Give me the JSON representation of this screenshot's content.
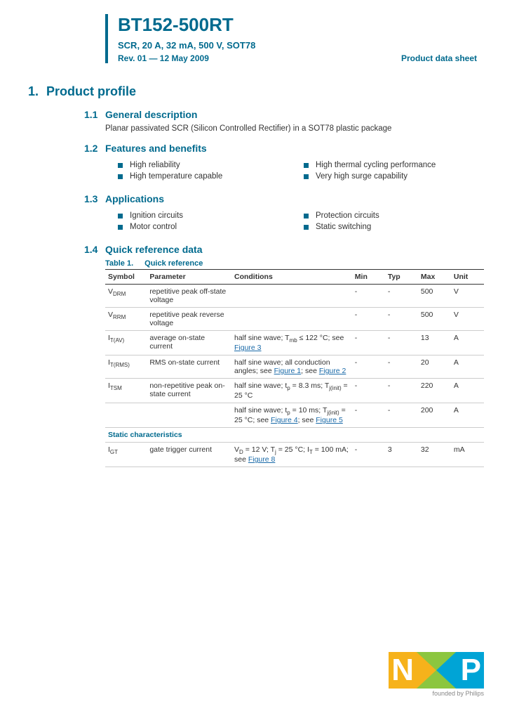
{
  "header": {
    "part_number": "BT152-500RT",
    "subtitle": "SCR, 20 A, 32 mA, 500 V, SOT78",
    "revision": "Rev. 01 — 12 May 2009",
    "sheet_type": "Product data sheet"
  },
  "sections": {
    "s1_num": "1.",
    "s1_title": "Product profile",
    "s11_num": "1.1",
    "s11_title": "General description",
    "s11_text": "Planar passivated SCR (Silicon Controlled Rectifier) in a SOT78 plastic package",
    "s12_num": "1.2",
    "s12_title": "Features and benefits",
    "s12_left": [
      "High reliability",
      "High temperature capable"
    ],
    "s12_right": [
      "High thermal cycling performance",
      "Very high surge capability"
    ],
    "s13_num": "1.3",
    "s13_title": "Applications",
    "s13_left": [
      "Ignition circuits",
      "Motor control"
    ],
    "s13_right": [
      "Protection circuits",
      "Static switching"
    ],
    "s14_num": "1.4",
    "s14_title": "Quick reference data"
  },
  "table": {
    "caption_num": "Table 1.",
    "caption_title": "Quick reference",
    "headers": [
      "Symbol",
      "Parameter",
      "Conditions",
      "Min",
      "Typ",
      "Max",
      "Unit"
    ],
    "section_row": "Static characteristics",
    "rows": [
      {
        "sym_pre": "V",
        "sym_sub": "DRM",
        "param": "repetitive peak off-state voltage",
        "cond": "",
        "min": "-",
        "typ": "-",
        "max": "500",
        "unit": "V"
      },
      {
        "sym_pre": "V",
        "sym_sub": "RRM",
        "param": "repetitive peak reverse voltage",
        "cond": "",
        "min": "-",
        "typ": "-",
        "max": "500",
        "unit": "V"
      },
      {
        "sym_pre": "I",
        "sym_sub": "T(AV)",
        "param": "average on-state current",
        "min": "-",
        "typ": "-",
        "max": "13",
        "unit": "A"
      },
      {
        "sym_pre": "I",
        "sym_sub": "T(RMS)",
        "param": "RMS on-state current",
        "min": "-",
        "typ": "-",
        "max": "20",
        "unit": "A"
      },
      {
        "sym_pre": "I",
        "sym_sub": "TSM",
        "param": "non-repetitive peak on-state current",
        "min": "-",
        "typ": "-",
        "max": "220",
        "unit": "A"
      },
      {
        "sym_pre": "",
        "sym_sub": "",
        "param": "",
        "min": "-",
        "typ": "-",
        "max": "200",
        "unit": "A"
      },
      {
        "sym_pre": "I",
        "sym_sub": "GT",
        "param": "gate trigger current",
        "min": "-",
        "typ": "3",
        "max": "32",
        "unit": "mA"
      }
    ],
    "cond_r3_a": "half sine wave; T",
    "cond_r3_b": " ≤ 122 °C; see ",
    "cond_r3_link": "Figure 3",
    "cond_r3_sub": "mb",
    "cond_r4_a": "half sine wave; all conduction angles; see ",
    "cond_r4_l1": "Figure 1",
    "cond_r4_mid": "; see ",
    "cond_r4_l2": "Figure 2",
    "cond_r5_a": "half sine wave; t",
    "cond_r5_sub1": "p",
    "cond_r5_b": " = 8.3 ms; T",
    "cond_r5_sub2": "j(init)",
    "cond_r5_c": " = 25 °C",
    "cond_r6_a": "half sine wave; t",
    "cond_r6_sub1": "p",
    "cond_r6_b": " = 10 ms; T",
    "cond_r6_sub2": "j(init)",
    "cond_r6_c": " = 25 °C; see ",
    "cond_r6_l1": "Figure 4",
    "cond_r6_d": "; see ",
    "cond_r6_l2": "Figure 5",
    "cond_r7_a": "V",
    "cond_r7_sub1": "D",
    "cond_r7_b": " = 12 V; T",
    "cond_r7_sub2": "j",
    "cond_r7_c": " = 25 °C; I",
    "cond_r7_sub3": "T",
    "cond_r7_d": " = 100 mA; see ",
    "cond_r7_link": "Figure 8"
  },
  "logo": {
    "n": "N",
    "p": "P",
    "tagline": "founded by Philips"
  }
}
